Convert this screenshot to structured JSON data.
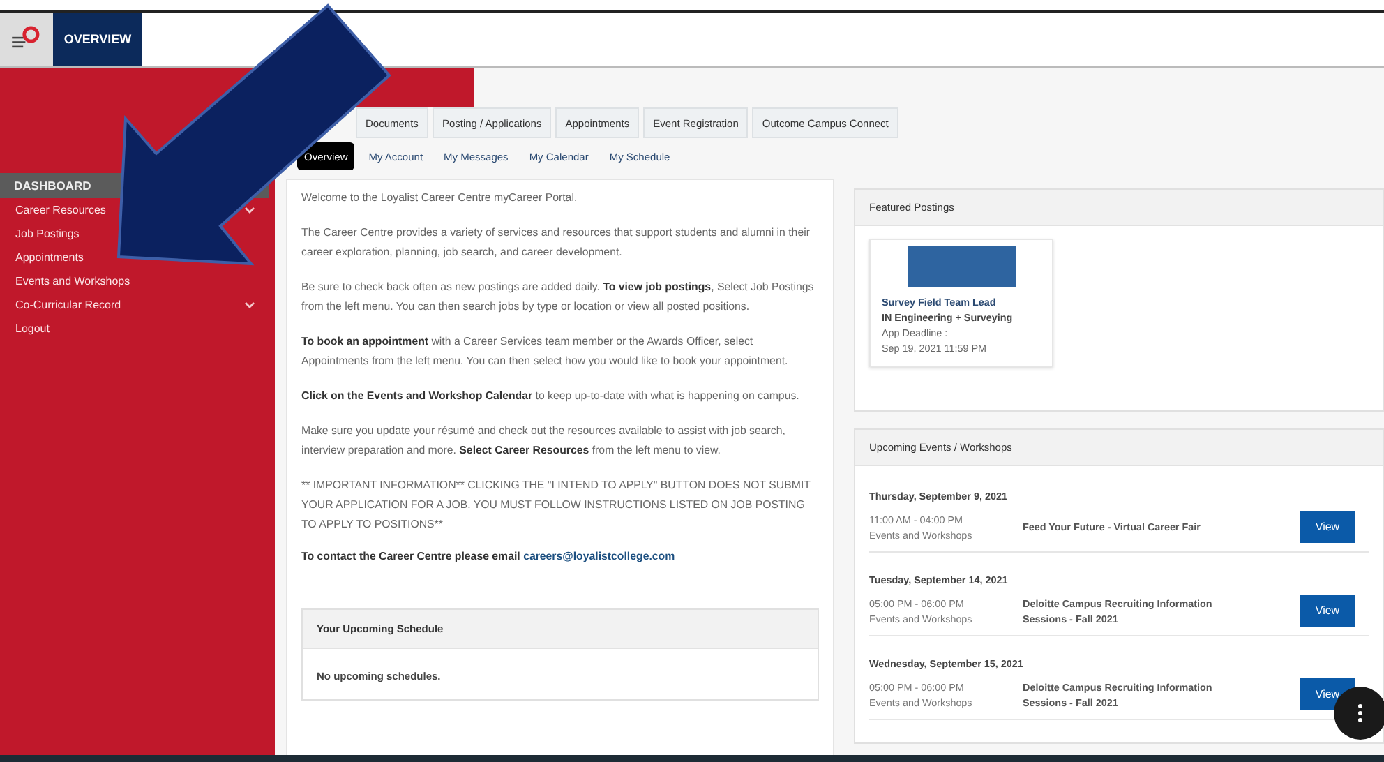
{
  "header": {
    "title": "OVERVIEW"
  },
  "sidebar": {
    "heading": "DASHBOARD",
    "items": [
      {
        "label": "Career Resources",
        "expandable": true
      },
      {
        "label": "Job Postings",
        "expandable": false
      },
      {
        "label": "Appointments",
        "expandable": false
      },
      {
        "label": "Events and Workshops",
        "expandable": false
      },
      {
        "label": "Co-Curricular Record",
        "expandable": true
      },
      {
        "label": "Logout",
        "expandable": false
      }
    ]
  },
  "tabs": [
    {
      "label": "Documents",
      "selected": false
    },
    {
      "label": "Posting / Applications",
      "selected": false
    },
    {
      "label": "Appointments",
      "selected": false
    },
    {
      "label": "Event Registration",
      "selected": false
    },
    {
      "label": "Outcome Campus Connect",
      "selected": false
    }
  ],
  "subtabs": [
    {
      "label": "Overview",
      "selected": true
    },
    {
      "label": "My Account",
      "selected": false
    },
    {
      "label": "My Messages",
      "selected": false
    },
    {
      "label": "My Calendar",
      "selected": false
    },
    {
      "label": "My Schedule",
      "selected": false
    }
  ],
  "welcome": {
    "paragraphs": [
      "Welcome to the Loyalist Career Centre myCareer Portal.",
      "The Career Centre provides a variety of services and resources that support students and alumni in their career exploration, planning, job search, and career development.",
      "Be sure to check back often as new postings are added daily.  **To view job postings**, Select Job Postings from the left menu.  You can then search jobs by type or location or view all posted positions.",
      "**To book an appointment** with a Career Services team member or the Awards Officer, select Appointments from the left menu.  You can then select how you would like to book your appointment.",
      "**Click on the Events and Workshop Calendar** to keep up-to-date with what is happening on campus.",
      "Make sure you update your résumé and check out the resources available to assist with job search, interview preparation and more. **Select Career Resources** from the left menu to view.",
      "** IMPORTANT INFORMATION**  CLICKING THE  \"I INTEND TO APPLY\" BUTTON DOES NOT SUBMIT YOUR APPLICATION FOR A JOB.  YOU MUST FOLLOW INSTRUCTIONS LISTED ON JOB POSTING TO APPLY TO POSITIONS**"
    ],
    "contact_text": "To contact the Career Centre please email",
    "contact_email": "careers@loyalistcollege.com"
  },
  "schedule": {
    "title": "Your Upcoming Schedule",
    "empty_text": "No upcoming schedules."
  },
  "featured": {
    "title": "Featured Postings",
    "postings": [
      {
        "title": "Survey Field Team Lead",
        "category": "IN Engineering + Surveying",
        "deadline_label": "App Deadline :",
        "deadline": "Sep 19, 2021 11:59 PM"
      }
    ]
  },
  "events": {
    "title": "Upcoming Events / Workshops",
    "items": [
      {
        "date": "Thursday, September 9, 2021",
        "time": "11:00 AM - 04:00 PM",
        "type": "Events and Workshops",
        "name": "Feed Your Future - Virtual Career Fair",
        "button": "View"
      },
      {
        "date": "Tuesday, September 14, 2021",
        "time": "05:00 PM - 06:00 PM",
        "type": "Events and Workshops",
        "name": "Deloitte Campus Recruiting Information Sessions - Fall 2021",
        "button": "View"
      },
      {
        "date": "Wednesday, September 15, 2021",
        "time": "05:00 PM - 06:00 PM",
        "type": "Events and Workshops",
        "name": "Deloitte Campus Recruiting Information Sessions - Fall 2021",
        "button": "View"
      }
    ]
  }
}
